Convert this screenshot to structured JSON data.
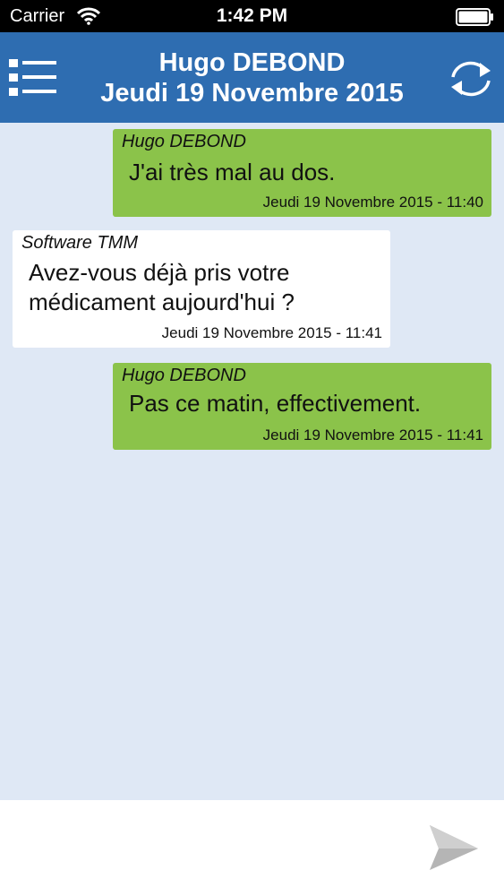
{
  "status_bar": {
    "carrier": "Carrier",
    "time": "1:42 PM"
  },
  "header": {
    "title": "Hugo DEBOND",
    "subtitle": "Jeudi 19 Novembre 2015",
    "menu_icon": "list-menu-icon",
    "refresh_icon": "refresh-icon",
    "color": "#2e6db1"
  },
  "messages": [
    {
      "direction": "sent",
      "author": "Hugo DEBOND",
      "text": "J'ai très mal au dos.",
      "timestamp": "Jeudi 19 Novembre 2015 - 11:40"
    },
    {
      "direction": "received",
      "author": "Software TMM",
      "text_lines": [
        "Avez-vous déjà pris votre",
        "médicament aujourd'hui ?"
      ],
      "timestamp": "Jeudi 19 Novembre 2015 - 11:41"
    },
    {
      "direction": "sent",
      "author": "Hugo DEBOND",
      "text": "Pas ce matin, effectivement.",
      "timestamp": "Jeudi 19 Novembre 2015 - 11:41"
    }
  ],
  "composer": {
    "value": "",
    "send_icon": "send-icon"
  },
  "colors": {
    "sent_bubble": "#8bc34a",
    "received_bubble": "#ffffff",
    "chat_background": "#dfe8f5"
  }
}
